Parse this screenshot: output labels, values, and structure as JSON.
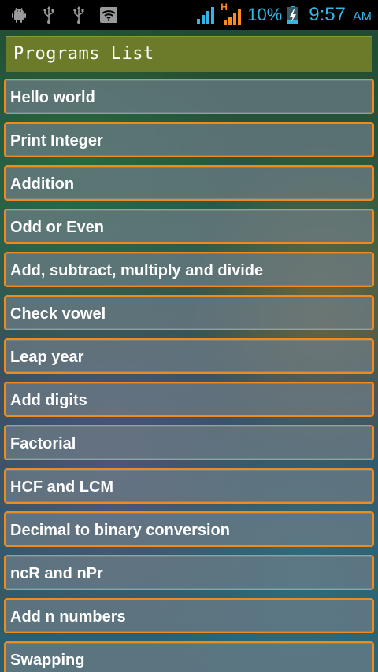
{
  "status_bar": {
    "icons_left": [
      "android-debug-icon",
      "usb-icon",
      "usb-icon",
      "wifi-icon"
    ],
    "network_type": "H",
    "battery_percent": "10%",
    "time": "9:57",
    "ampm": "AM",
    "accent_color": "#33b5e5"
  },
  "title_bar": {
    "title": "Programs List",
    "background_color": "#6b7b2a"
  },
  "programs": {
    "items": [
      "Hello world",
      "Print Integer",
      "Addition",
      "Odd or Even",
      "Add, subtract, multiply and divide",
      "Check vowel",
      "Leap year",
      "Add digits",
      "Factorial",
      "HCF and LCM",
      "Decimal to binary conversion",
      "ncR and nPr",
      "Add n numbers",
      "Swapping"
    ],
    "border_color": "#f08a1c"
  }
}
